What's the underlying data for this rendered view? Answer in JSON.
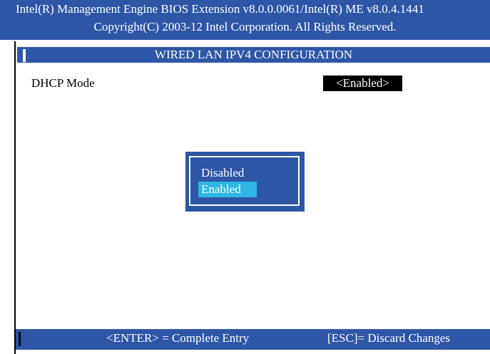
{
  "header": {
    "line1": "Intel(R) Management Engine BIOS Extension v8.0.0.0061/Intel(R) ME v8.0.4.1441",
    "line2": "Copyright(C) 2003-12 Intel Corporation. All Rights Reserved."
  },
  "page": {
    "title": "WIRED LAN IPV4 CONFIGURATION"
  },
  "settings": {
    "dhcp_mode": {
      "label": "DHCP Mode",
      "value": "<Enabled>"
    }
  },
  "popup": {
    "options": [
      "Disabled",
      "Enabled"
    ],
    "selected": "Enabled"
  },
  "footer": {
    "enter_hint": "<ENTER> = Complete Entry",
    "esc_hint": "[ESC]= Discard Changes"
  },
  "colors": {
    "bios_blue": "#2e56a7",
    "highlight_cyan": "#2eb6e4",
    "text_white": "#ffffff",
    "text_black": "#000000"
  }
}
